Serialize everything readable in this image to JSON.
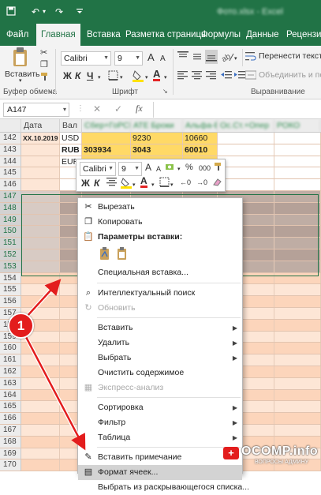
{
  "titlebar": {
    "document_title": "Фото.xlsx - Excel"
  },
  "tabs": [
    {
      "label": "Файл",
      "active": false
    },
    {
      "label": "Главная",
      "active": true
    },
    {
      "label": "Вставка",
      "active": false
    },
    {
      "label": "Разметка страницы",
      "active": false
    },
    {
      "label": "Формулы",
      "active": false
    },
    {
      "label": "Данные",
      "active": false
    },
    {
      "label": "Рецензи",
      "active": false
    }
  ],
  "ribbon": {
    "paste_label": "Вставить",
    "clipboard_group": "Буфер обмена",
    "font_group": "Шрифт",
    "align_group": "Выравнивание",
    "font_name": "Calibri",
    "font_size": "9",
    "grow_font": "A",
    "shrink_font": "A",
    "bold": "Ж",
    "italic": "К",
    "underline": "Ч",
    "font_color_letter": "A",
    "wrap_text": "Перенести текст",
    "merge_center": "Объединить и по"
  },
  "formula_bar": {
    "name_box": "A147",
    "cancel": "✕",
    "enter": "✓",
    "fx": "fx"
  },
  "columns": [
    {
      "label": "",
      "blur": false
    },
    {
      "label": "Дата",
      "blur": false
    },
    {
      "label": "Вал",
      "blur": false
    },
    {
      "label": "Сбер+ГоРСКо",
      "blur": true
    },
    {
      "label": "АТЕ Броки",
      "blur": true
    },
    {
      "label": "Альфа-Б",
      "blur": true
    },
    {
      "label": "Ос.Ст.+Опер",
      "blur": true
    },
    {
      "label": "РОКО",
      "blur": true
    }
  ],
  "rows": [
    {
      "n": "142",
      "date": "XX.10.2019",
      "cur": "USD",
      "c1": "",
      "c2": "9230",
      "c3": "10660",
      "bold": false
    },
    {
      "n": "143",
      "date": "",
      "cur": "RUB",
      "c1": "303934",
      "c2": "3043",
      "c3": "60010",
      "bold": true
    },
    {
      "n": "144",
      "date": "",
      "cur": "EUR",
      "c1": "",
      "c2": "",
      "c3": "",
      "bold": false
    },
    {
      "n": "145",
      "date": "",
      "cur": "",
      "c1": "",
      "c2": "",
      "c3": "",
      "bold": false
    },
    {
      "n": "146",
      "date": "",
      "cur": "",
      "c1": "",
      "c2": "",
      "c3": "",
      "bold": false
    },
    {
      "n": "147",
      "date": "",
      "cur": "",
      "c1": "",
      "c2": "",
      "c3": "",
      "bold": false
    },
    {
      "n": "148",
      "date": "",
      "cur": "",
      "c1": "",
      "c2": "",
      "c3": "",
      "bold": false
    },
    {
      "n": "149",
      "date": "",
      "cur": "",
      "c1": "",
      "c2": "",
      "c3": "",
      "bold": false
    },
    {
      "n": "150",
      "date": "",
      "cur": "",
      "c1": "",
      "c2": "",
      "c3": "",
      "bold": false
    },
    {
      "n": "151",
      "date": "",
      "cur": "",
      "c1": "",
      "c2": "",
      "c3": "",
      "bold": false
    },
    {
      "n": "152",
      "date": "",
      "cur": "",
      "c1": "",
      "c2": "",
      "c3": "",
      "bold": false
    },
    {
      "n": "153",
      "date": "",
      "cur": "",
      "c1": "",
      "c2": "",
      "c3": "",
      "bold": false
    },
    {
      "n": "154",
      "date": "",
      "cur": "",
      "c1": "",
      "c2": "",
      "c3": "",
      "bold": false
    },
    {
      "n": "155",
      "date": "",
      "cur": "",
      "c1": "",
      "c2": "",
      "c3": "",
      "bold": false
    },
    {
      "n": "156",
      "date": "",
      "cur": "",
      "c1": "",
      "c2": "",
      "c3": "",
      "bold": false
    },
    {
      "n": "157",
      "date": "",
      "cur": "",
      "c1": "",
      "c2": "",
      "c3": "",
      "bold": false
    },
    {
      "n": "158",
      "date": "",
      "cur": "",
      "c1": "",
      "c2": "",
      "c3": "",
      "bold": false
    },
    {
      "n": "159",
      "date": "",
      "cur": "",
      "c1": "",
      "c2": "",
      "c3": "",
      "bold": false
    },
    {
      "n": "160",
      "date": "",
      "cur": "",
      "c1": "",
      "c2": "",
      "c3": "",
      "bold": false
    },
    {
      "n": "161",
      "date": "",
      "cur": "",
      "c1": "",
      "c2": "",
      "c3": "",
      "bold": false
    },
    {
      "n": "162",
      "date": "",
      "cur": "",
      "c1": "",
      "c2": "",
      "c3": "",
      "bold": false
    },
    {
      "n": "163",
      "date": "",
      "cur": "",
      "c1": "",
      "c2": "",
      "c3": "",
      "bold": false
    },
    {
      "n": "164",
      "date": "",
      "cur": "",
      "c1": "",
      "c2": "",
      "c3": "",
      "bold": false
    },
    {
      "n": "165",
      "date": "",
      "cur": "",
      "c1": "",
      "c2": "",
      "c3": "",
      "bold": false
    },
    {
      "n": "166",
      "date": "",
      "cur": "",
      "c1": "",
      "c2": "",
      "c3": "",
      "bold": false
    },
    {
      "n": "167",
      "date": "",
      "cur": "",
      "c1": "",
      "c2": "",
      "c3": "",
      "bold": false
    },
    {
      "n": "168",
      "date": "",
      "cur": "",
      "c1": "",
      "c2": "",
      "c3": "",
      "bold": false
    },
    {
      "n": "169",
      "date": "",
      "cur": "",
      "c1": "",
      "c2": "",
      "c3": "",
      "bold": false
    },
    {
      "n": "170",
      "date": "",
      "cur": "",
      "c1": "",
      "c2": "",
      "c3": "",
      "bold": false
    }
  ],
  "mini_toolbar": {
    "font": "Calibri",
    "size": "9",
    "bold": "Ж",
    "italic": "К",
    "pct": "%",
    "thousands": "000"
  },
  "context_menu": {
    "items": [
      {
        "label": "Вырезать",
        "icon": "cut-icon",
        "glyph": "✂",
        "type": "item"
      },
      {
        "label": "Копировать",
        "icon": "copy-icon",
        "glyph": "❐",
        "type": "item"
      },
      {
        "label": "Параметры вставки:",
        "icon": "paste-icon",
        "glyph": "📋",
        "type": "header"
      },
      {
        "label": "",
        "type": "paste-options"
      },
      {
        "label": "Специальная вставка...",
        "type": "item"
      },
      {
        "label": "Интеллектуальный поиск",
        "icon": "smart-lookup-icon",
        "glyph": "⌕",
        "type": "item"
      },
      {
        "label": "Обновить",
        "icon": "refresh-icon",
        "glyph": "↻",
        "type": "disabled"
      },
      {
        "label": "Вставить",
        "type": "submenu"
      },
      {
        "label": "Удалить",
        "type": "submenu"
      },
      {
        "label": "Выбрать",
        "type": "submenu"
      },
      {
        "label": "Очистить содержимое",
        "type": "item"
      },
      {
        "label": "Экспресс-анализ",
        "icon": "quick-analysis-icon",
        "glyph": "▦",
        "type": "disabled"
      },
      {
        "label": "Сортировка",
        "type": "submenu"
      },
      {
        "label": "Фильтр",
        "type": "submenu"
      },
      {
        "label": "Таблица",
        "type": "submenu"
      },
      {
        "label": "Вставить примечание",
        "icon": "comment-icon",
        "glyph": "✎",
        "type": "item"
      },
      {
        "label": "Формат ячеек...",
        "icon": "format-cells-icon",
        "glyph": "▤",
        "type": "highlighted"
      },
      {
        "label": "Выбрать из раскрывающегося списка...",
        "type": "item"
      }
    ]
  },
  "annotation": {
    "badge_number": "1"
  },
  "watermark": {
    "line1": "OCOMP.info",
    "line2": "ВОПРОСЫ АДМИНУ"
  },
  "colors": {
    "excel_green": "#217346",
    "row_orange": "#fcd8c0",
    "row_gold": "#ffd966",
    "selection": "#b09c93",
    "badge_red": "#e31d1d"
  }
}
